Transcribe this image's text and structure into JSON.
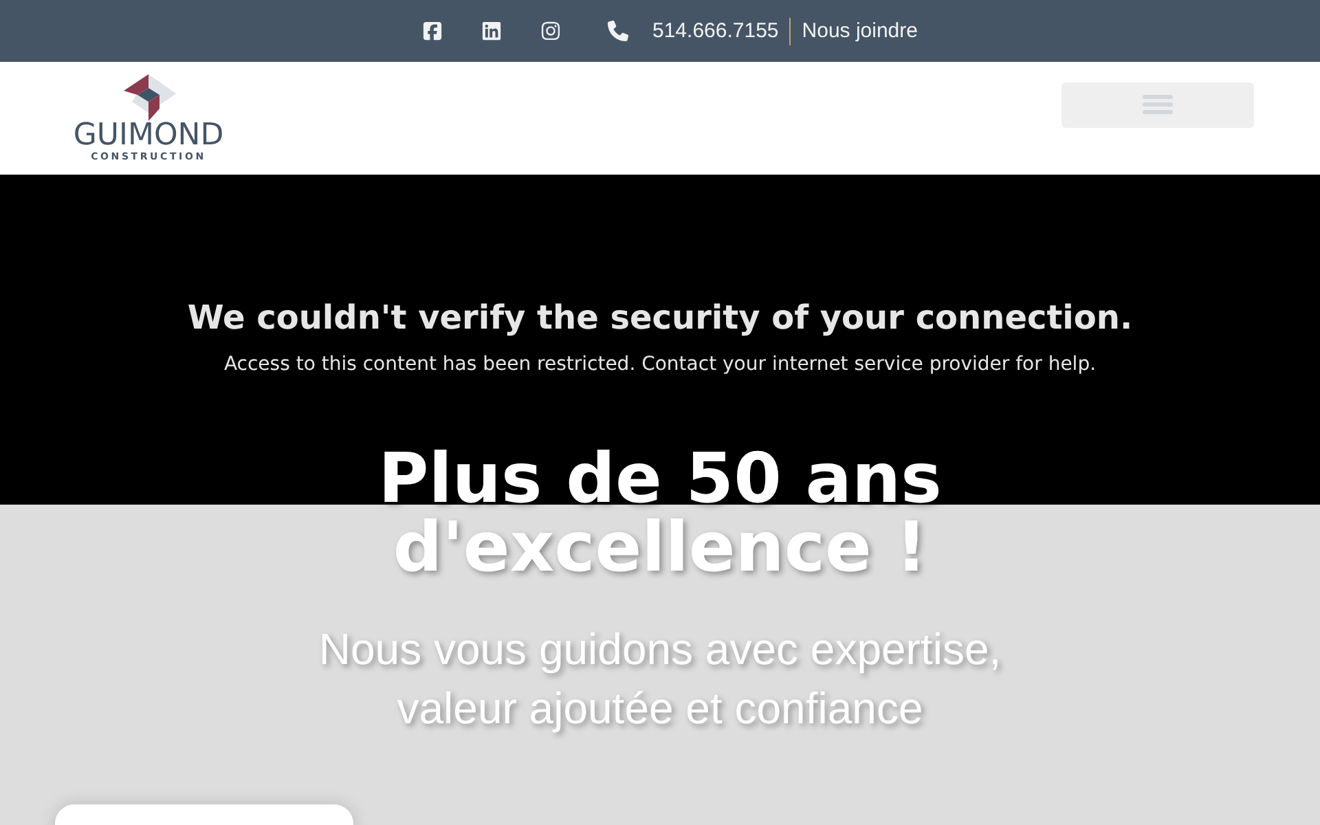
{
  "top_bar": {
    "phone": "514.666.7155",
    "contact_link": "Nous joindre"
  },
  "logo": {
    "name": "GUIMOND",
    "subtitle": "CONSTRUCTION"
  },
  "notice": {
    "title": "We couldn't verify the security of your connection.",
    "message": "Access to this content has been restricted. Contact your internet service provider for help."
  },
  "hero": {
    "title_lines": [
      "Plus de 50 ans",
      "d'excellence !"
    ],
    "subtitle_lines": [
      "Nous vous guidons avec expertise,",
      "valeur ajoutée et confiance"
    ]
  }
}
